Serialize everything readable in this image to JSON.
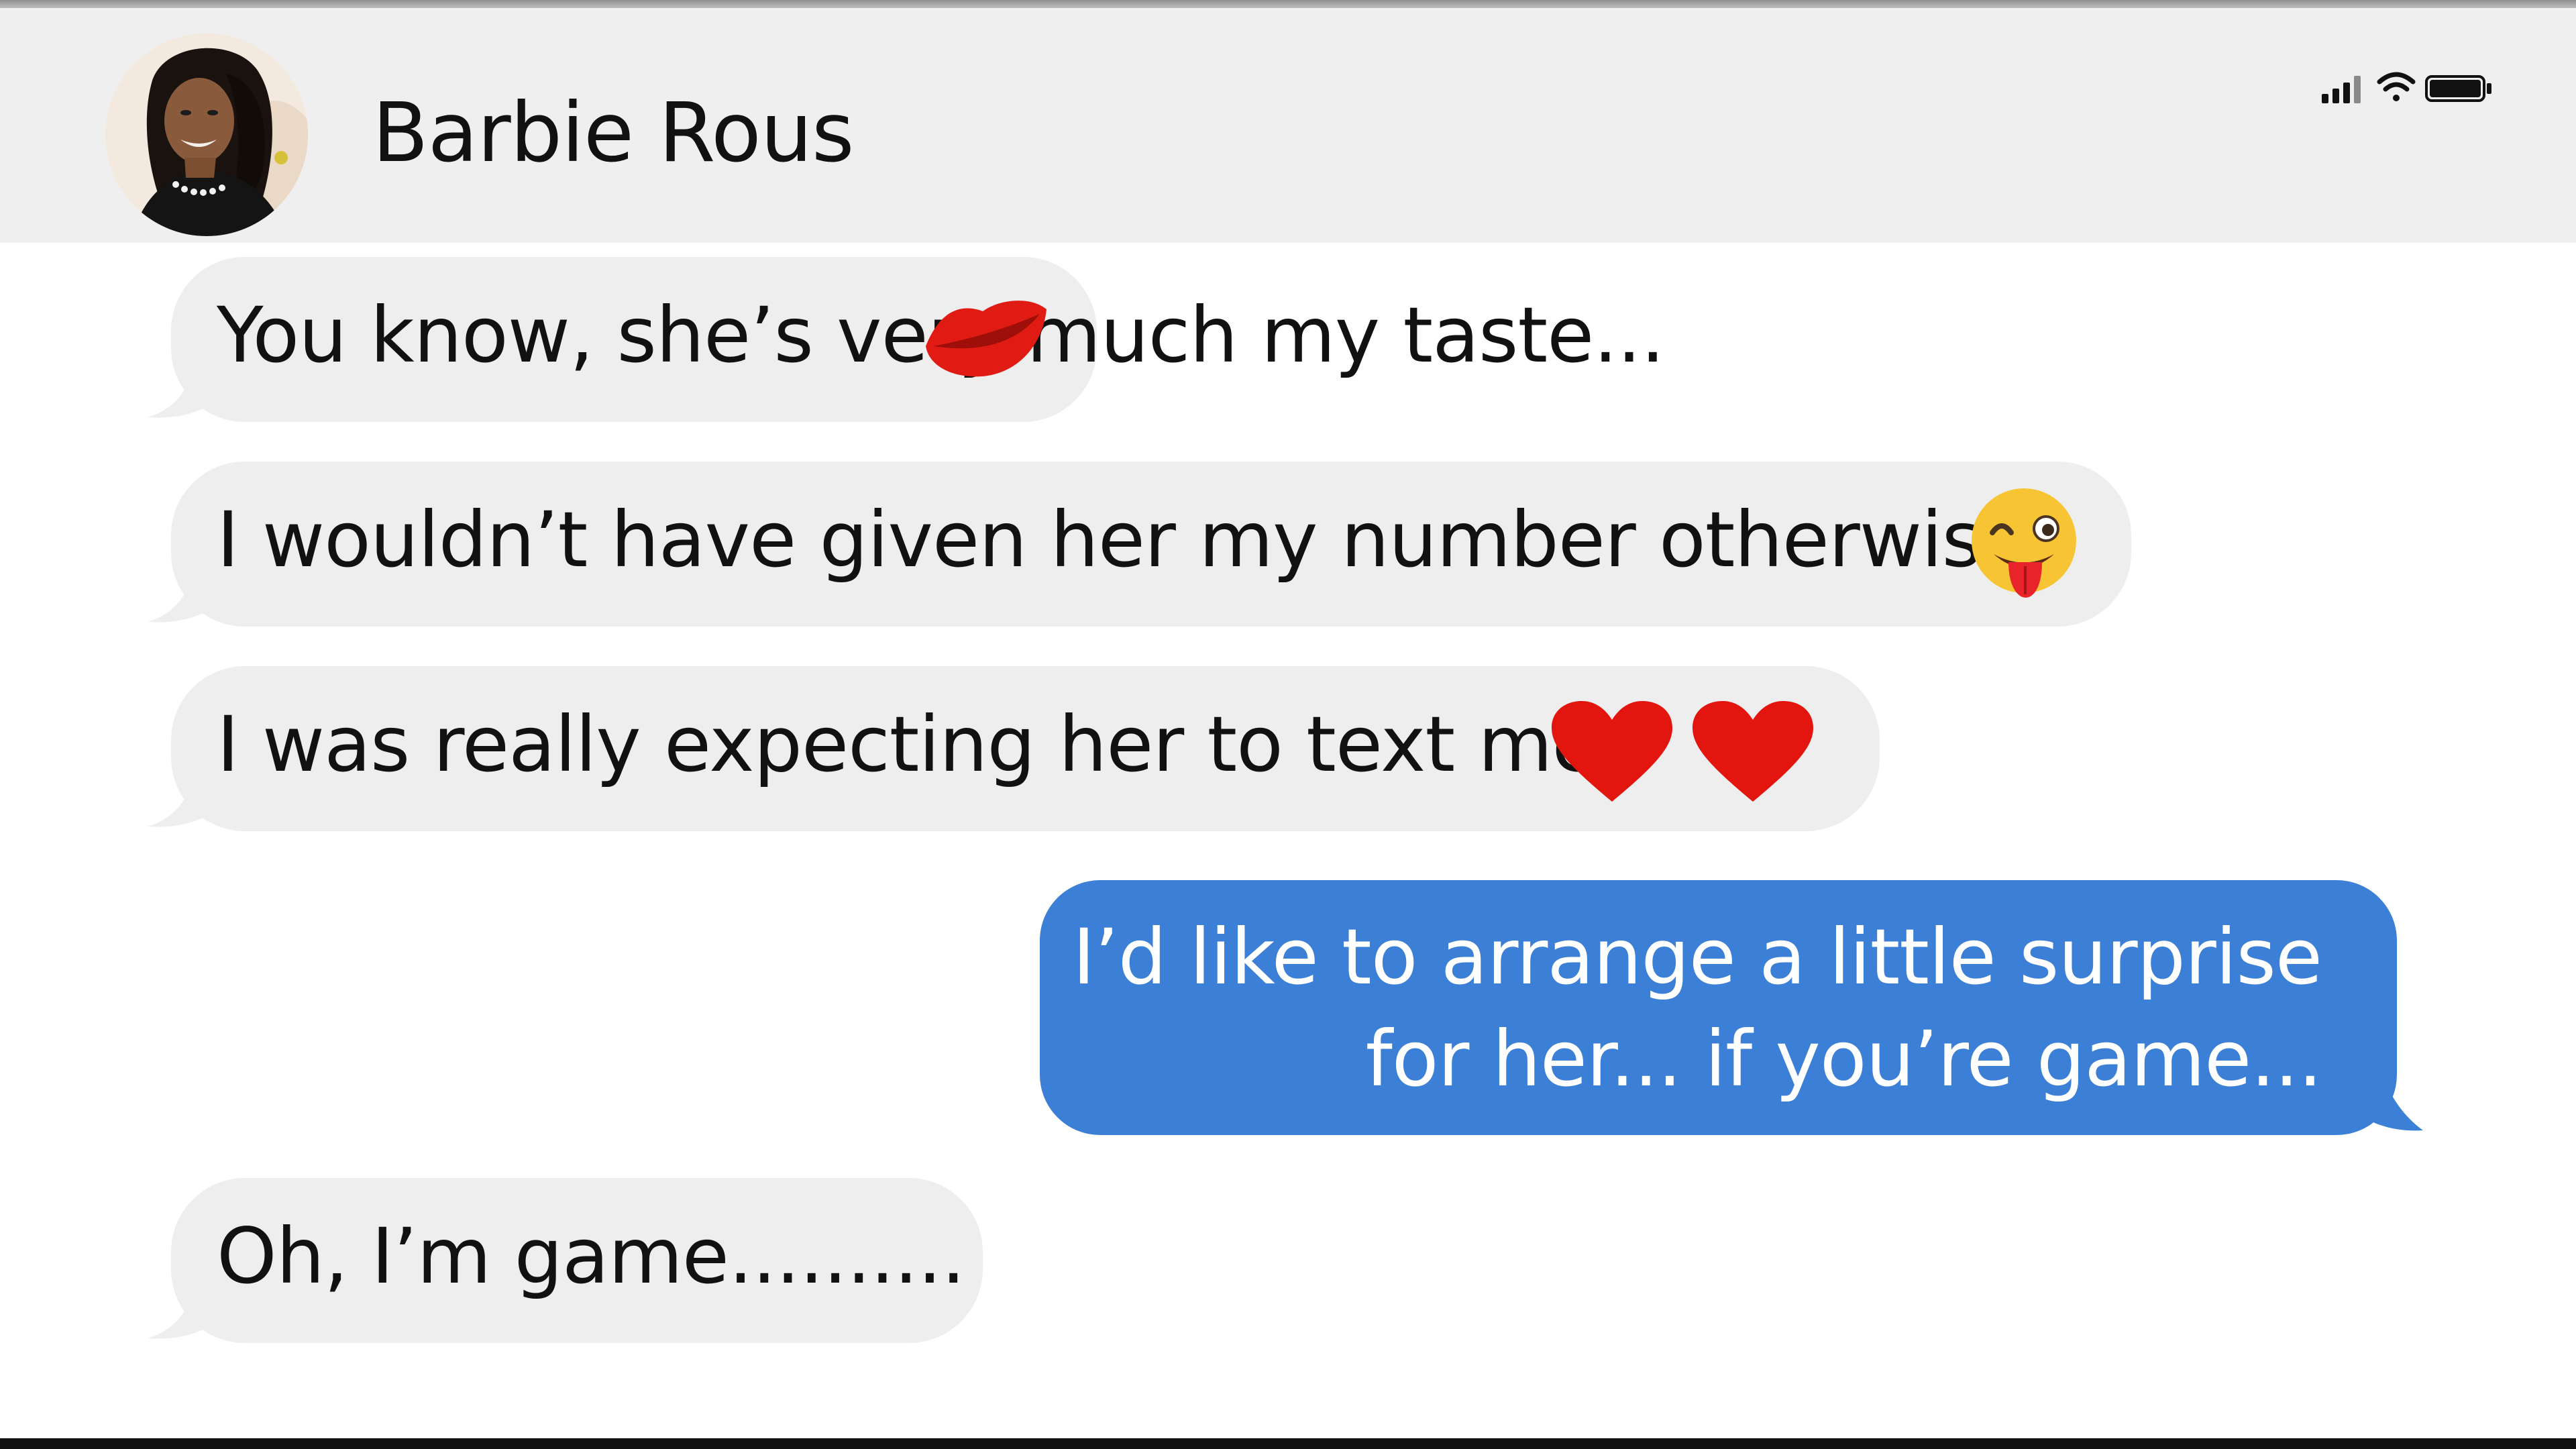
{
  "header": {
    "contact_name": "Barbie Rous",
    "avatar": "contact-photo",
    "status_icons": [
      "cellular-signal-icon",
      "wifi-icon",
      "battery-icon"
    ]
  },
  "colors": {
    "header_bg": "#efefef",
    "incoming_bubble": "#eeeeee",
    "outgoing_bubble": "#3b7fd6",
    "incoming_text": "#111111",
    "outgoing_text": "#ffffff"
  },
  "messages": [
    {
      "direction": "incoming",
      "text": "You know, she’s very much my taste...",
      "emoji": [
        "kiss-mark-icon"
      ]
    },
    {
      "direction": "incoming",
      "text": "I wouldn’t have given her my number otherwise",
      "emoji": [
        "winking-face-with-tongue-icon"
      ]
    },
    {
      "direction": "incoming",
      "text": "I was really expecting her to text me",
      "emoji": [
        "red-heart-icon",
        "red-heart-icon"
      ]
    },
    {
      "direction": "outgoing",
      "lines": [
        "I’d like to arrange a little surprise",
        "for her... if you’re game..."
      ]
    },
    {
      "direction": "incoming",
      "text": "Oh, I’m game.........."
    }
  ]
}
